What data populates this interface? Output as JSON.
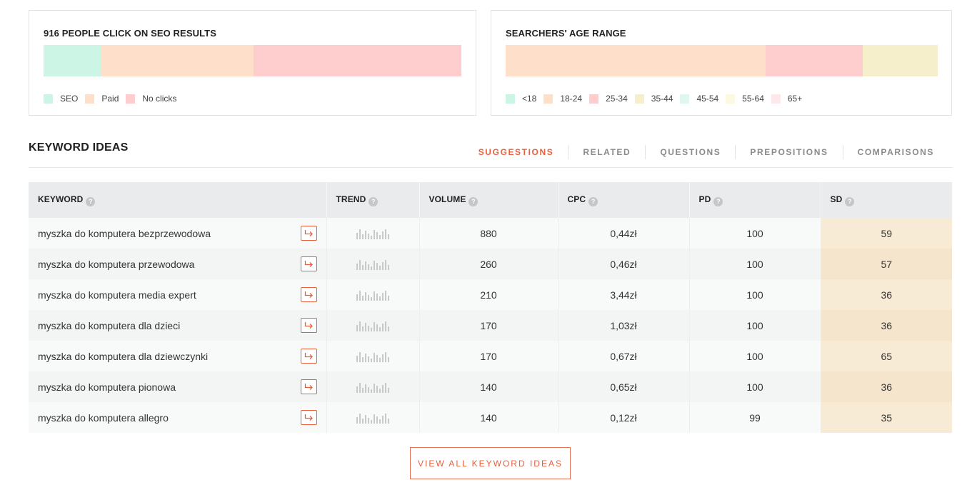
{
  "seo_card": {
    "title": "916 PEOPLE CLICK ON SEO RESULTS",
    "segments": [
      {
        "label": "SEO",
        "share": 0.138,
        "color": "#cdf5e5"
      },
      {
        "label": "Paid",
        "share": 0.365,
        "color": "#fedfca"
      },
      {
        "label": "No clicks",
        "share": 0.497,
        "color": "#fecdcd"
      }
    ]
  },
  "age_card": {
    "title": "SEARCHERS' AGE RANGE",
    "segments": [
      {
        "label": "<18",
        "share": 0.0,
        "color": "#cdf5e5"
      },
      {
        "label": "18-24",
        "share": 0.601,
        "color": "#fedfca"
      },
      {
        "label": "25-34",
        "share": 0.226,
        "color": "#fecdcd"
      },
      {
        "label": "35-44",
        "share": 0.173,
        "color": "#f6efcb"
      },
      {
        "label": "45-54",
        "share": 0.0,
        "color": "#dff7ec"
      },
      {
        "label": "55-64",
        "share": 0.0,
        "color": "#fdf8e2"
      },
      {
        "label": "65+",
        "share": 0.0,
        "color": "#fde9ec"
      }
    ]
  },
  "keyword_ideas": {
    "title": "KEYWORD IDEAS",
    "tabs": [
      {
        "label": "SUGGESTIONS",
        "active": true
      },
      {
        "label": "RELATED",
        "active": false
      },
      {
        "label": "QUESTIONS",
        "active": false
      },
      {
        "label": "PREPOSITIONS",
        "active": false
      },
      {
        "label": "COMPARISONS",
        "active": false
      }
    ],
    "columns": {
      "keyword": "KEYWORD",
      "trend": "TREND",
      "volume": "VOLUME",
      "cpc": "CPC",
      "pd": "PD",
      "sd": "SD"
    },
    "help_glyph": "?",
    "rows": [
      {
        "keyword": "myszka do komputera bezprzewodowa",
        "volume": "880",
        "cpc": "0,44zł",
        "pd": "100",
        "sd": "59"
      },
      {
        "keyword": "myszka do komputera przewodowa",
        "volume": "260",
        "cpc": "0,46zł",
        "pd": "100",
        "sd": "57"
      },
      {
        "keyword": "myszka do komputera media expert",
        "volume": "210",
        "cpc": "3,44zł",
        "pd": "100",
        "sd": "36"
      },
      {
        "keyword": "myszka do komputera dla dzieci",
        "volume": "170",
        "cpc": "1,03zł",
        "pd": "100",
        "sd": "36"
      },
      {
        "keyword": "myszka do komputera dla dziewczynki",
        "volume": "170",
        "cpc": "0,67zł",
        "pd": "100",
        "sd": "65"
      },
      {
        "keyword": "myszka do komputera pionowa",
        "volume": "140",
        "cpc": "0,65zł",
        "pd": "100",
        "sd": "36"
      },
      {
        "keyword": "myszka do komputera allegro",
        "volume": "140",
        "cpc": "0,12zł",
        "pd": "99",
        "sd": "35"
      }
    ],
    "view_all_label": "VIEW ALL KEYWORD IDEAS"
  },
  "colors": {
    "accent": "#e8613c",
    "sd_cell": "#f7ebd6",
    "header_bg": "#e9ebec"
  },
  "icons": {
    "row_action": "arrow-redirect-icon",
    "trend": "mini-bar-chart-icon",
    "help": "question-circle-icon"
  }
}
